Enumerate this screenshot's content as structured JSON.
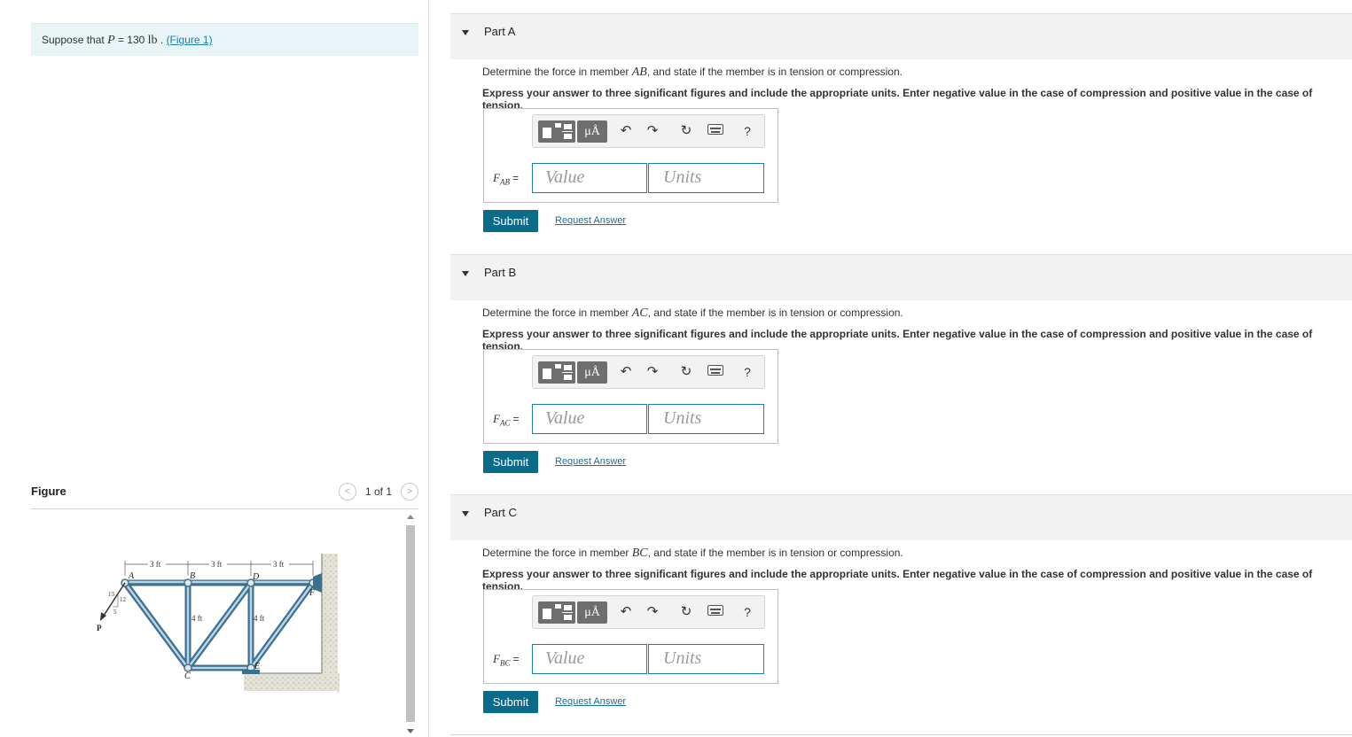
{
  "intro": {
    "prefix": "Suppose that ",
    "var": "P",
    "value": " = 130 ",
    "unit": "lb",
    "dot": " . ",
    "figure_link": "(Figure 1)"
  },
  "figure": {
    "title": "Figure",
    "counter": "1 of 1",
    "prev_icon": "<",
    "next_icon": ">",
    "labels": {
      "dim1": "3 ft",
      "dim2": "3 ft",
      "dim3": "3 ft",
      "h1": "4 ft",
      "h2": "4 ft",
      "A": "A",
      "B": "B",
      "C": "C",
      "D": "D",
      "E": "E",
      "F": "F",
      "P": "P",
      "s13": "13",
      "s12": "12",
      "s5": "5"
    }
  },
  "toolbar": {
    "mu_label": "μÅ",
    "undo": "↶",
    "redo": "↷",
    "reset": "↻",
    "help": "?"
  },
  "parts": [
    {
      "title": "Part A",
      "q1_prefix": "Determine the force in member ",
      "member": "AB",
      "q1_suffix": ", and state if the member is in tension or compression.",
      "q2": "Express your answer to three significant figures and include the appropriate units. Enter negative value in the case of compression and positive value in the case of tension.",
      "var": "F",
      "sub": "AB",
      "eq": "=",
      "value_placeholder": "Value",
      "units_placeholder": "Units",
      "submit": "Submit",
      "request": "Request Answer"
    },
    {
      "title": "Part B",
      "q1_prefix": "Determine the force in member ",
      "member": "AC",
      "q1_suffix": ", and state if the member is in tension or compression.",
      "q2": "Express your answer to three significant figures and include the appropriate units. Enter negative value in the case of compression and positive value in the case of tension.",
      "var": "F",
      "sub": "AC",
      "eq": "=",
      "value_placeholder": "Value",
      "units_placeholder": "Units",
      "submit": "Submit",
      "request": "Request Answer"
    },
    {
      "title": "Part C",
      "q1_prefix": "Determine the force in member ",
      "member": "BC",
      "q1_suffix": ", and state if the member is in tension or compression.",
      "q2": "Express your answer to three significant figures and include the appropriate units. Enter negative value in the case of compression and positive value in the case of tension.",
      "var": "F",
      "sub": "BC",
      "eq": "=",
      "value_placeholder": "Value",
      "units_placeholder": "Units",
      "submit": "Submit",
      "request": "Request Answer"
    }
  ]
}
